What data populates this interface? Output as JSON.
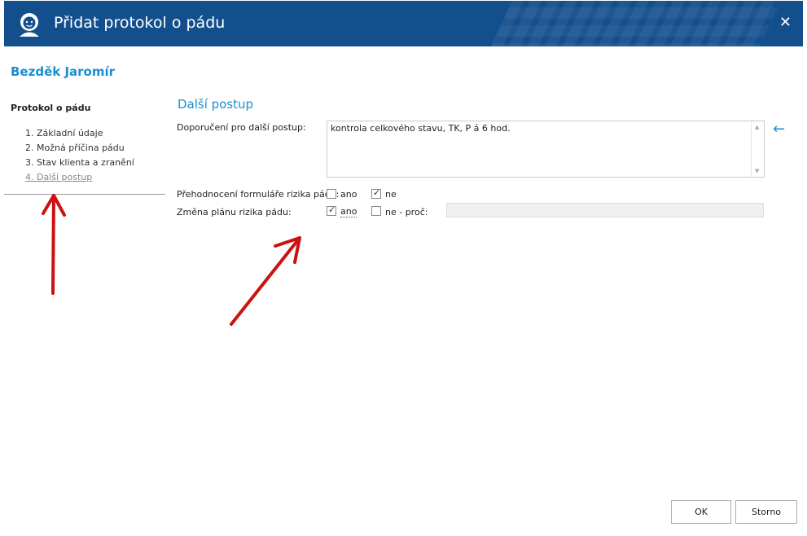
{
  "window": {
    "title": "Přidat protokol o pádu",
    "close_icon": "close-icon",
    "close_glyph": "✕"
  },
  "client": {
    "name": "Bezděk Jaromír"
  },
  "nav": {
    "title": "Protokol o pádu",
    "items": [
      {
        "label": "1. Základní údaje"
      },
      {
        "label": "2. Možná příčina pádu"
      },
      {
        "label": "3. Stav klienta a zranění"
      },
      {
        "label": "4. Další postup",
        "active": true
      }
    ]
  },
  "section": {
    "title": "Další postup",
    "recommendation_label": "Doporučení pro další postup:",
    "recommendation_value": "kontrola celkového stavu, TK, P á 6 hod.",
    "reassessment_label": "Přehodnocení formuláře rizika pádů:",
    "reassessment_yes": "ano",
    "reassessment_no": "ne",
    "reassessment_value": "ne",
    "plan_change_label": "Změna plánu rizika pádu:",
    "plan_change_yes": "ano",
    "plan_change_no": "ne - proč:",
    "plan_change_value": "ano",
    "reason_value": ""
  },
  "buttons": {
    "ok": "OK",
    "cancel": "Storno"
  },
  "colors": {
    "title_bar": "#144f8d",
    "accent": "#1a8fd0",
    "annotation_arrow": "#cc1111"
  }
}
